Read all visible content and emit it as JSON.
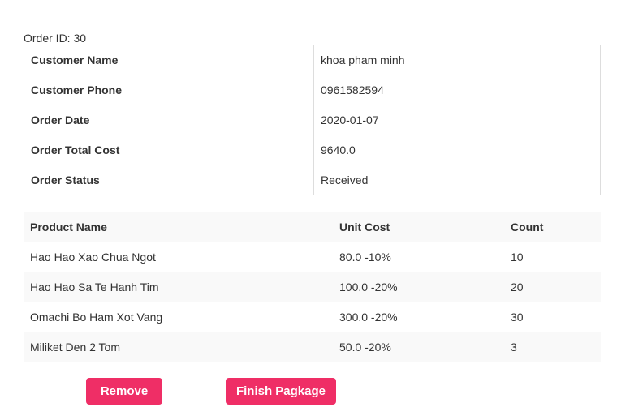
{
  "order": {
    "id_label": "Order ID: 30"
  },
  "info": [
    {
      "label": "Customer Name",
      "value": "khoa pham minh"
    },
    {
      "label": "Customer Phone",
      "value": "0961582594"
    },
    {
      "label": "Order Date",
      "value": "2020-01-07"
    },
    {
      "label": "Order Total Cost",
      "value": "9640.0"
    },
    {
      "label": "Order Status",
      "value": "Received"
    }
  ],
  "products": {
    "headers": [
      "Product Name",
      "Unit Cost",
      "Count"
    ],
    "rows": [
      {
        "name": "Hao Hao Xao Chua Ngot",
        "unit_cost": "80.0 -10%",
        "count": "10"
      },
      {
        "name": "Hao Hao Sa Te Hanh Tim",
        "unit_cost": "100.0 -20%",
        "count": "20"
      },
      {
        "name": "Omachi Bo Ham Xot Vang",
        "unit_cost": "300.0 -20%",
        "count": "30"
      },
      {
        "name": "Miliket Den 2 Tom",
        "unit_cost": "50.0 -20%",
        "count": "3"
      }
    ]
  },
  "actions": {
    "remove_label": "Remove",
    "finish_label": "Finish Pagkage",
    "accent_color": "#ef2e66"
  }
}
